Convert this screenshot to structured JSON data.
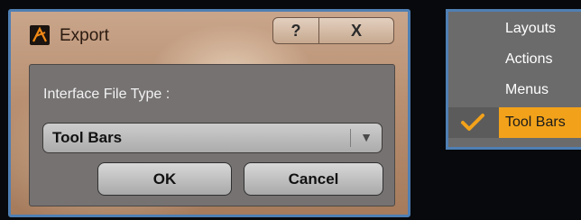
{
  "dialog": {
    "title": "Export",
    "help_label": "?",
    "close_label": "X",
    "field_label": "Interface File Type :",
    "file_type_value": "Tool Bars",
    "dropdown_arrow": "▼",
    "ok_label": "OK",
    "cancel_label": "Cancel"
  },
  "menu": {
    "items": [
      {
        "label": "Layouts",
        "checked": false
      },
      {
        "label": "Actions",
        "checked": false
      },
      {
        "label": "Menus",
        "checked": false
      },
      {
        "label": "Tool Bars",
        "checked": true
      }
    ]
  },
  "colors": {
    "border_blue": "#4f7fb3",
    "highlight_orange": "#f2a21a",
    "panel_gray": "#767272"
  },
  "icons": [
    "app-logo-icon",
    "help-icon",
    "close-icon",
    "dropdown-arrow-icon",
    "checkmark-icon"
  ]
}
